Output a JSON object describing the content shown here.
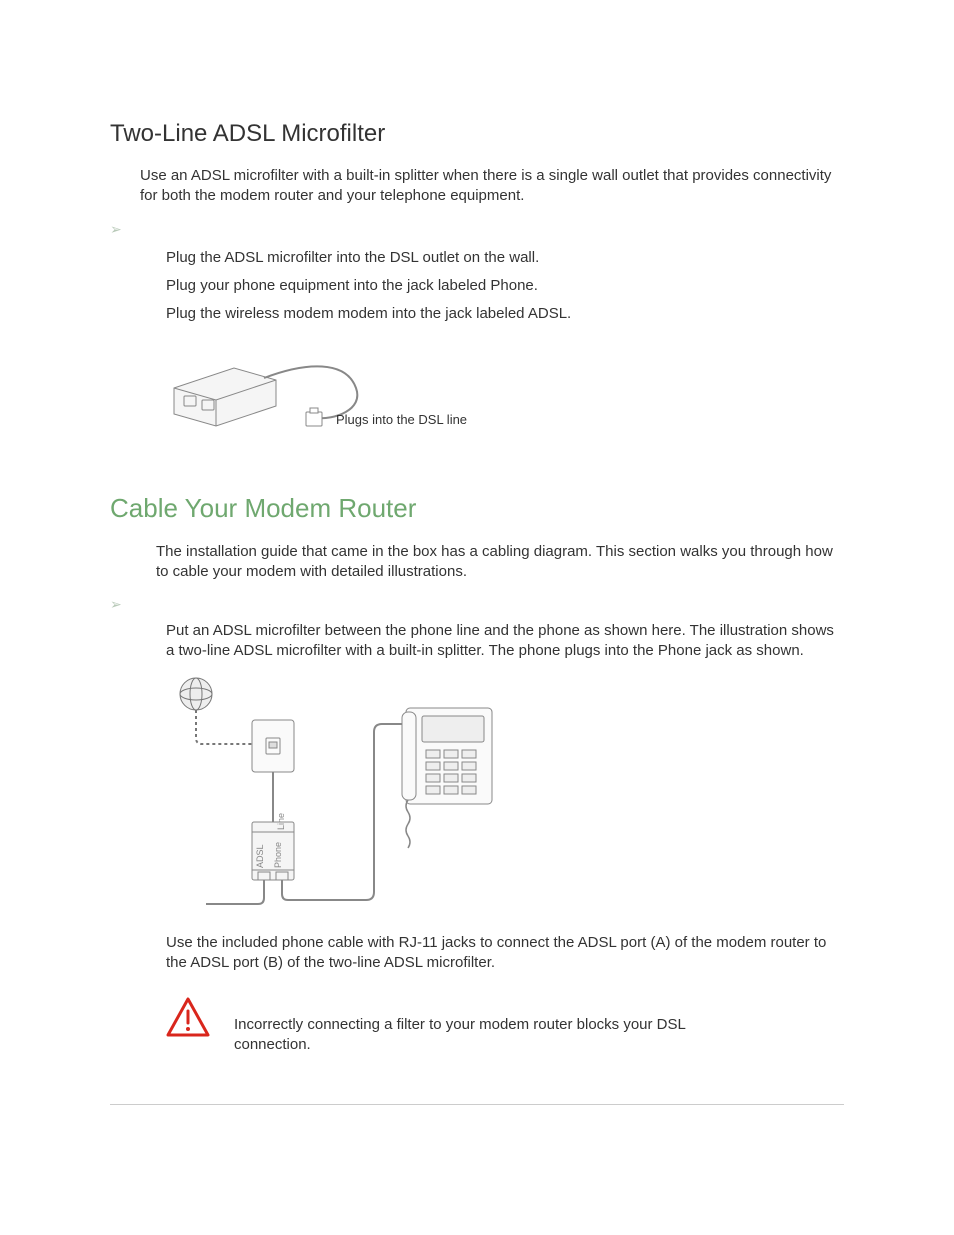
{
  "section1": {
    "heading": "Two-Line ADSL Microfilter",
    "intro": "Use an ADSL microfilter with a built-in splitter when there is a single wall outlet that provides connectivity for both the modem router and your telephone equipment.",
    "steps": [
      "Plug the ADSL microfilter into the DSL outlet on the wall.",
      "Plug your phone equipment into the jack labeled Phone.",
      "Plug the wireless modem modem into the jack labeled ADSL."
    ],
    "fig_caption": "Plugs into the DSL line"
  },
  "section2": {
    "heading": "Cable Your Modem Router",
    "intro": "The installation guide that came in the box has a cabling diagram. This section walks you through how to cable your modem with detailed illustrations.",
    "step1": "Put an ADSL microfilter between the phone line and the phone as shown here. The illustration shows a two-line ADSL microfilter with a built-in splitter. The phone plugs into the Phone jack as shown.",
    "step2": "Use the included phone cable with RJ-11 jacks to connect the ADSL port (A) of the modem router to the ADSL port (B) of the two-line ADSL microfilter.",
    "caution": "Incorrectly connecting a filter to your modem router blocks your DSL connection.",
    "diag_labels": {
      "line": "Line",
      "adsl": "ADSL",
      "phone": "Phone"
    }
  }
}
